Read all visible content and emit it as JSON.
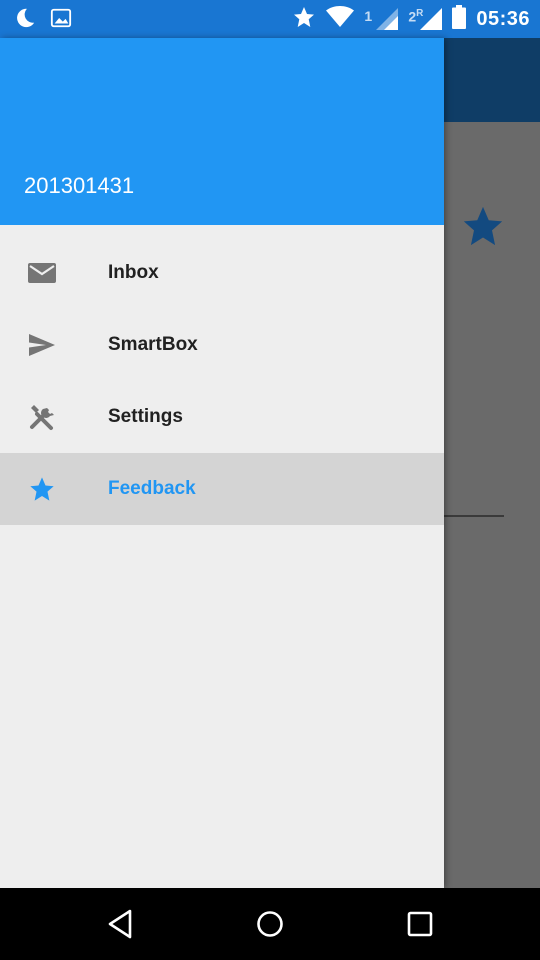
{
  "status_bar": {
    "time": "05:36",
    "sim1_label": "1",
    "sim2_label": "2",
    "sim2_roaming": "R",
    "icons": [
      "moon-icon",
      "image-icon",
      "star-icon",
      "wifi-icon",
      "signal-icon",
      "signal-icon",
      "battery-icon"
    ]
  },
  "drawer": {
    "user_name": "201301431",
    "items": [
      {
        "label": "Inbox",
        "icon": "mail-icon",
        "active": false
      },
      {
        "label": "SmartBox",
        "icon": "send-icon",
        "active": false
      },
      {
        "label": "Settings",
        "icon": "tools-icon",
        "active": false
      },
      {
        "label": "Feedback",
        "icon": "star-icon",
        "active": true
      }
    ]
  },
  "colors": {
    "primary": "#2196F3",
    "primary_dark": "#1976D2",
    "drawer_bg": "#EEEEEE",
    "active_item_bg": "#D4D4D4",
    "scrim": "#666666"
  },
  "nav_bar": {
    "buttons": [
      "back-icon",
      "home-icon",
      "recents-icon"
    ]
  }
}
